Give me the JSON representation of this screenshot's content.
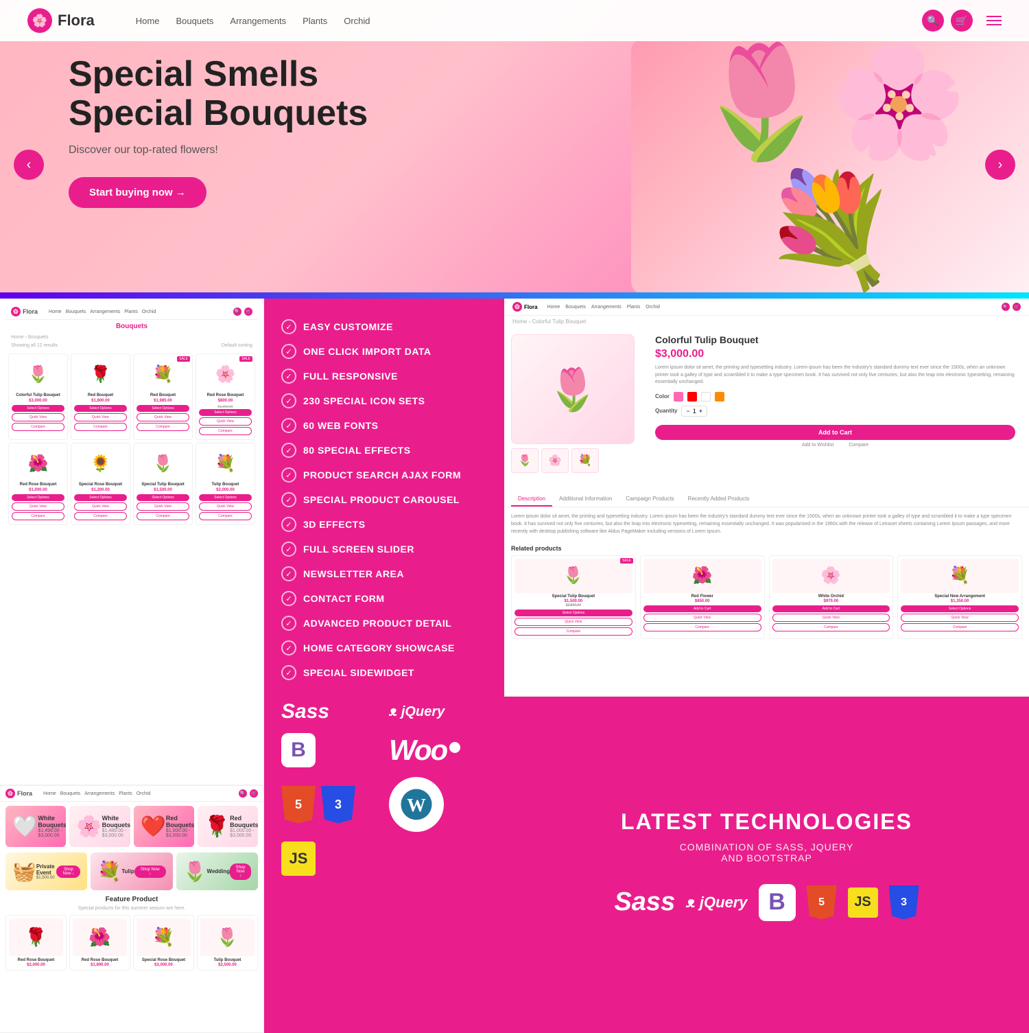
{
  "hero": {
    "logo": "Flora",
    "nav_links": [
      "Home",
      "Bouquets",
      "Arrangements",
      "Plants",
      "Orchid"
    ],
    "title_line1": "Special Smells",
    "title_line2": "Special Bouquets",
    "subtitle": "Discover our top-rated flowers!",
    "cta_button": "Start buying now →",
    "arrow_left": "‹",
    "arrow_right": "›"
  },
  "features": {
    "items": [
      "EASY CUSTOMIZE",
      "ONE CLICK IMPORT DATA",
      "FULL RESPONSIVE",
      "230 SPECIAL ICON SETS",
      "60 WEB FONTS",
      "80 SPECIAL EFFECTS",
      "PRODUCT SEARCH AJAX FORM",
      "SPECIAL PRODUCT CAROUSEL",
      "3D EFFECTS",
      "FULL SCREEN SLIDER",
      "NEWSLETTER AREA",
      "CONTACT FORM",
      "ADVANCED PRODUCT DETAIL",
      "HOME CATEGORY SHOWCASE",
      "SPECIAL SIDEWIDGET"
    ]
  },
  "shop1": {
    "logo": "Flora",
    "nav_links": [
      "Home",
      "Bouquets",
      "Arrangements",
      "Plants",
      "Orchid"
    ],
    "section_title": "Bouquets",
    "breadcrumb": "Home › Bouquets",
    "results": "Showing all 12 results",
    "sort_label": "Default sorting",
    "products": [
      {
        "name": "Colorful Tulip Bouquet",
        "price": "$3,000.00",
        "old_price": "",
        "emoji": "🌷",
        "badge": ""
      },
      {
        "name": "Red Bouquet",
        "price": "$1,800.00",
        "old_price": "",
        "emoji": "🌹",
        "badge": ""
      },
      {
        "name": "Red Bouquet",
        "price": "$1,985.00",
        "old_price": "",
        "emoji": "💐",
        "badge": "SALE"
      },
      {
        "name": "Red Rose Bouquet",
        "price": "$800.00",
        "old_price": "$1,200.00",
        "emoji": "🌸",
        "badge": "SALE"
      },
      {
        "name": "Red Rose Bouquet",
        "price": "$1,000.00",
        "old_price": "",
        "emoji": "🌺",
        "badge": ""
      },
      {
        "name": "Special Rose Bouquet",
        "price": "$1,200.00",
        "old_price": "",
        "emoji": "🌻",
        "badge": ""
      },
      {
        "name": "Special Tulip Bouquet",
        "price": "$1,500.00",
        "old_price": "",
        "emoji": "🌷",
        "badge": ""
      },
      {
        "name": "Tulip Bouquet",
        "price": "$2,000.00",
        "old_price": "",
        "emoji": "💐",
        "badge": ""
      }
    ]
  },
  "shop2": {
    "logo": "Flora",
    "nav_links": [
      "Home",
      "Bouquets",
      "Arrangements",
      "Plants",
      "Orchid"
    ],
    "banners": [
      {
        "text": "White Bouquets",
        "price_from": "$1,499.00",
        "price_to": "$3,000.00",
        "emoji": "🤍",
        "type": "pink"
      },
      {
        "text": "White Bouquets",
        "price_from": "$1,489.00",
        "price_to": "$3,000.00",
        "emoji": "🌸",
        "type": "light"
      },
      {
        "text": "Red Bouquets",
        "price_from": "$1,000.00",
        "price_to": "$3,000.00",
        "emoji": "❤️",
        "type": "pink"
      },
      {
        "text": "Red Bouquets",
        "price_from": "$1,000.00",
        "price_to": "$3,000.00",
        "emoji": "🌹",
        "type": "light"
      }
    ],
    "featured_title": "Feature Product",
    "featured_sub": "Special products for this summer season are here.",
    "featured_products": [
      {
        "name": "Red Rose Bouquet",
        "price": "$2,000.00",
        "emoji": "🌹"
      },
      {
        "name": "Red Rose Bouquet",
        "price": "$1,890.00",
        "emoji": "🌺"
      },
      {
        "name": "Special Rose Bouquet",
        "price": "$3,000.00",
        "emoji": "💐"
      },
      {
        "name": "Tulip Bouquet",
        "price": "$2,500.00",
        "emoji": "🌷"
      }
    ]
  },
  "product_detail": {
    "logo": "Flora",
    "nav_links": [
      "Home",
      "Bouquets",
      "Arrangements",
      "Plants",
      "Orchid"
    ],
    "breadcrumb": "Home › Colorful Tulip Bouquet",
    "title": "Colorful Tulip Bouquet",
    "price": "$3,000.00",
    "description": "Lorem ipsum dolor sit amet, the printing and typesetting industry. Lorem ipsum has been the industry's standard dummy text ever since the 1500s, when an unknown printer took a galley of type and scrambled it to make a type specimen book. It has survived not only five centuries, but also the leap into electronic typesetting, remaining essentially unchanged.",
    "color_label": "Color",
    "qty_label": "Quantity",
    "qty_value": "1",
    "add_to_cart": "Add to Cart",
    "add_to_wishlist": "Add to Wishlist",
    "compare": "Compare",
    "tabs": [
      "Description",
      "Additional Information",
      "Campaign Products",
      "Recently Added Products"
    ],
    "tab_desc": "Lorem ipsum dolor sit amet, the printing and typesetting industry. Lorem ipsum has been the industry's standard dummy text ever since the 1500s, when an unknown printer took a galley of type and scrambled it to make a type specimen book. It has survived not only five centuries, but also the leap into electronic typesetting, remaining essentially unchanged. It was popularised in the 1960s with the release of Letraset sheets containing Lorem Ipsum passages, and more recently with desktop publishing software like Aldus PageMaker including versions of Lorem Ipsum.",
    "related_title": "Related products",
    "related_products": [
      {
        "name": "Special Tulip Bouquet",
        "price": "$1,500.00",
        "old_price": "$2,800.00",
        "emoji": "🌷",
        "badge": "SALE"
      },
      {
        "name": "Red Flower",
        "price": "$850.00",
        "old_price": "",
        "emoji": "🌺",
        "badge": ""
      },
      {
        "name": "White Orchid",
        "price": "$970.00",
        "old_price": "",
        "emoji": "🌸",
        "badge": ""
      },
      {
        "name": "Special New Arrangement",
        "price": "$1,350.00",
        "old_price": "",
        "emoji": "💐",
        "badge": ""
      }
    ]
  },
  "latest_tech": {
    "title": "LATEST TECHNOLOGIES",
    "subtitle": "COMBINATION OF SASS, JQUERY\nAND BOOTSTRAP"
  },
  "tech_badges": {
    "sass": "Sass",
    "jquery": "jQuery",
    "bootstrap_b": "B",
    "html5": "5",
    "js": "JS",
    "css3": "3"
  }
}
